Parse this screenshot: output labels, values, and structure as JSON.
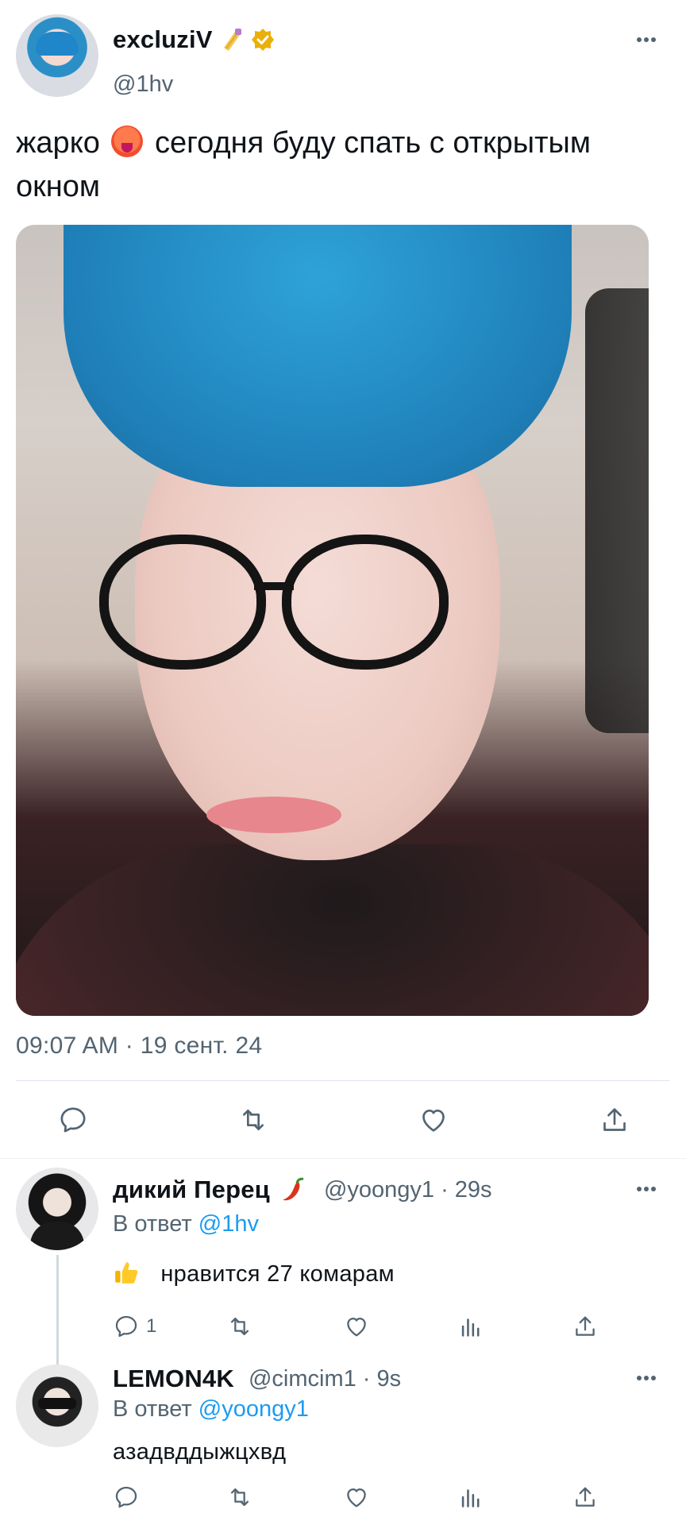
{
  "main_tweet": {
    "display_name": "excluziV",
    "handle": "@1hv",
    "text_before": "жарко",
    "text_after": "сегодня буду спать с открытым окном",
    "timestamp": "09:07 AM · 19 сент. 24",
    "icons": {
      "name_emoji": "nail-polish-icon",
      "verified": "verified-badge-icon",
      "more": "more-horizontal-icon",
      "text_emoji": "hot-face-icon"
    },
    "actions": {
      "reply_icon": "reply-icon",
      "retweet_icon": "retweet-icon",
      "like_icon": "heart-icon",
      "share_icon": "share-icon"
    }
  },
  "replies": [
    {
      "display_name": "дикий Перец",
      "name_emoji": "hot-pepper-icon",
      "handle_time": "@yoongy1 · 29s",
      "in_reply_prefix": "В ответ",
      "in_reply_mention": "@1hv",
      "text": "нравится 27 комарам",
      "text_emoji": "thumbs-up-icon",
      "reply_count": "1"
    },
    {
      "display_name": "LEMON4K",
      "handle_time": "@cimcim1 · 9s",
      "in_reply_prefix": "В ответ",
      "in_reply_mention": "@yoongy1",
      "text": "азадвддыжцхвд",
      "reply_count": ""
    }
  ],
  "colors": {
    "text": "#0f1419",
    "secondary": "#536471",
    "accent": "#1d9bf0",
    "verified": "#e9b00c"
  }
}
